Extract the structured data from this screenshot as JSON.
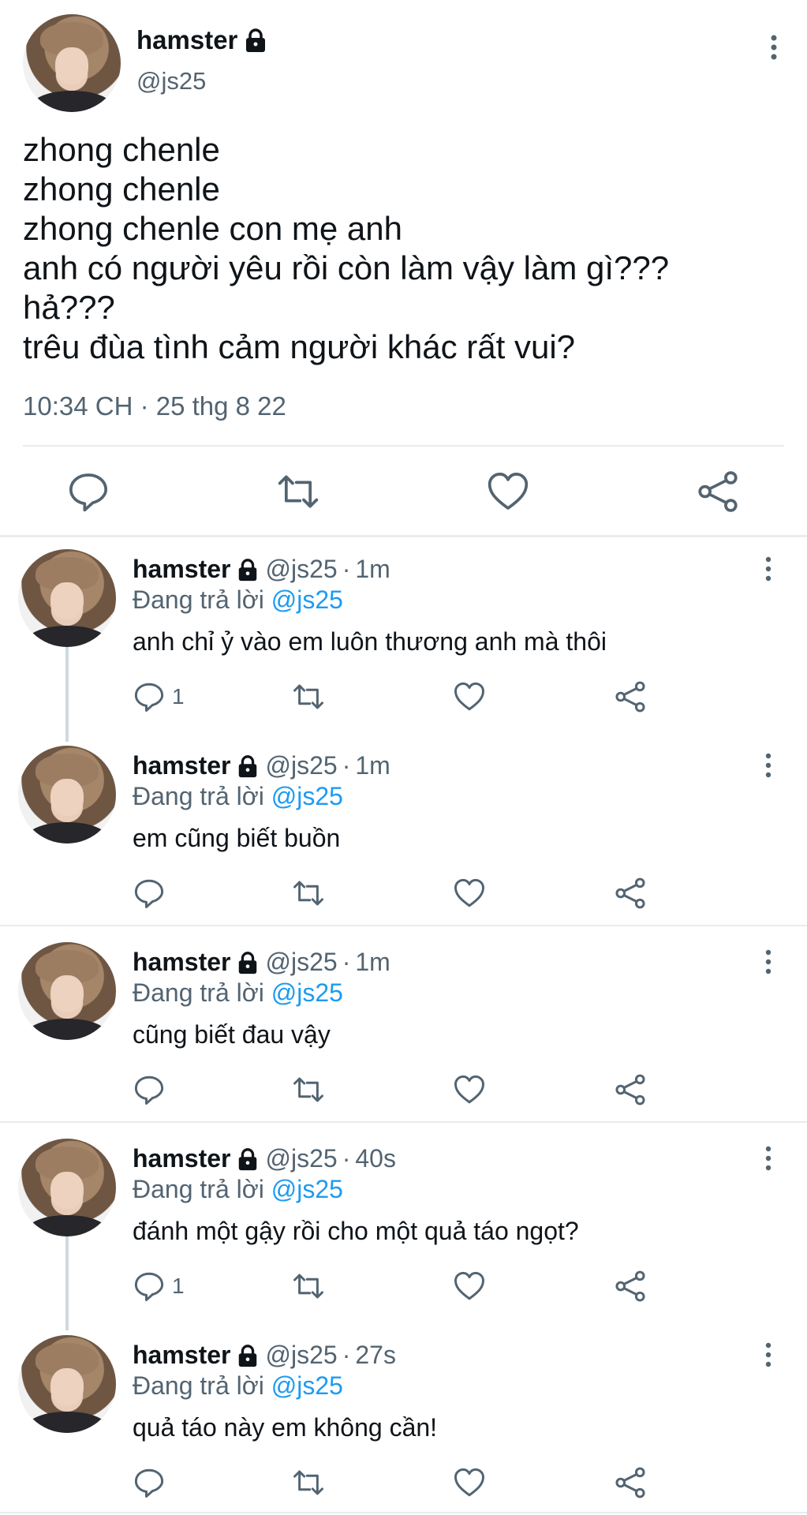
{
  "main": {
    "name": "hamster",
    "handle": "@js25",
    "lines": [
      "zhong chenle",
      "zhong chenle",
      "zhong chenle con mẹ anh",
      "anh có người yêu rồi còn làm vậy làm gì???",
      "hả???",
      "trêu đùa tình cảm người khác rất vui?"
    ],
    "timestamp": "10:34 CH · 25 thg 8 22",
    "actions": [
      "reply-icon",
      "retweet-icon",
      "like-icon",
      "share-icon"
    ]
  },
  "replies": [
    {
      "name": "hamster",
      "handle": "@js25",
      "sep": "·",
      "time": "1m",
      "replying_prefix": "Đang trả lời ",
      "replying_to": "@js25",
      "text": "anh chỉ ỷ vào em luôn thương anh mà thôi",
      "reply_count": "1"
    },
    {
      "name": "hamster",
      "handle": "@js25",
      "sep": "·",
      "time": "1m",
      "replying_prefix": "Đang trả lời ",
      "replying_to": "@js25",
      "text": "em cũng biết buồn",
      "reply_count": ""
    },
    {
      "name": "hamster",
      "handle": "@js25",
      "sep": "·",
      "time": "1m",
      "replying_prefix": "Đang trả lời ",
      "replying_to": "@js25",
      "text": "cũng biết đau vậy",
      "reply_count": ""
    },
    {
      "name": "hamster",
      "handle": "@js25",
      "sep": "·",
      "time": "40s",
      "replying_prefix": "Đang trả lời ",
      "replying_to": "@js25",
      "text": "đánh một gậy rồi cho một quả táo ngọt?",
      "reply_count": "1"
    },
    {
      "name": "hamster",
      "handle": "@js25",
      "sep": "·",
      "time": "27s",
      "replying_prefix": "Đang trả lời ",
      "replying_to": "@js25",
      "text": "quả táo này em không cần!",
      "reply_count": ""
    }
  ],
  "colors": {
    "accent": "#1d9bf0",
    "muted": "#536471",
    "text": "#0f1419",
    "divider": "#e6ecf0",
    "thread": "#cfd9de"
  }
}
